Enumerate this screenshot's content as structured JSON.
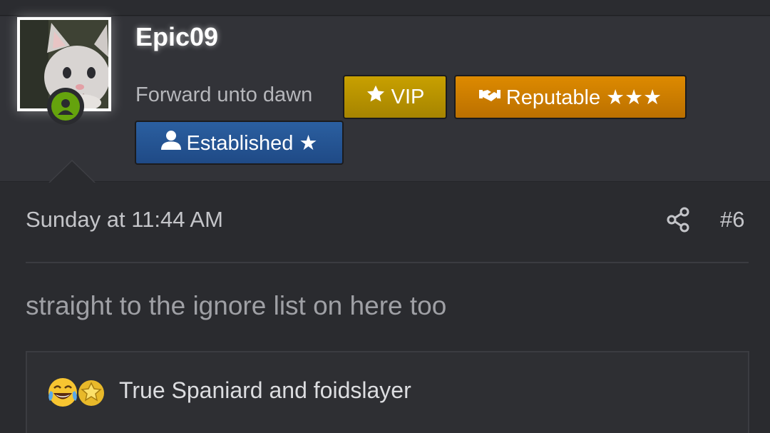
{
  "user": {
    "username": "Epic09",
    "title": "Forward unto dawn",
    "status_icon": "user-online-icon",
    "avatar": "cat-avatar"
  },
  "badges": [
    {
      "label": "VIP",
      "icon": "star-icon",
      "color": "#b89200"
    },
    {
      "label": "Reputable ★★★",
      "icon": "handshake-icon",
      "color": "#cc7c00"
    },
    {
      "label": "Established ★",
      "icon": "user-icon",
      "color": "#2557a0"
    }
  ],
  "post": {
    "date": "Sunday at 11:44 AM",
    "number": "#6",
    "share_icon": "share-icon",
    "message": "straight to the ignore list on here too"
  },
  "signature": {
    "text": "True Spaniard and foidslayer",
    "emojis": [
      "laughing-crying-emoji",
      "star-struck-emoji"
    ]
  }
}
